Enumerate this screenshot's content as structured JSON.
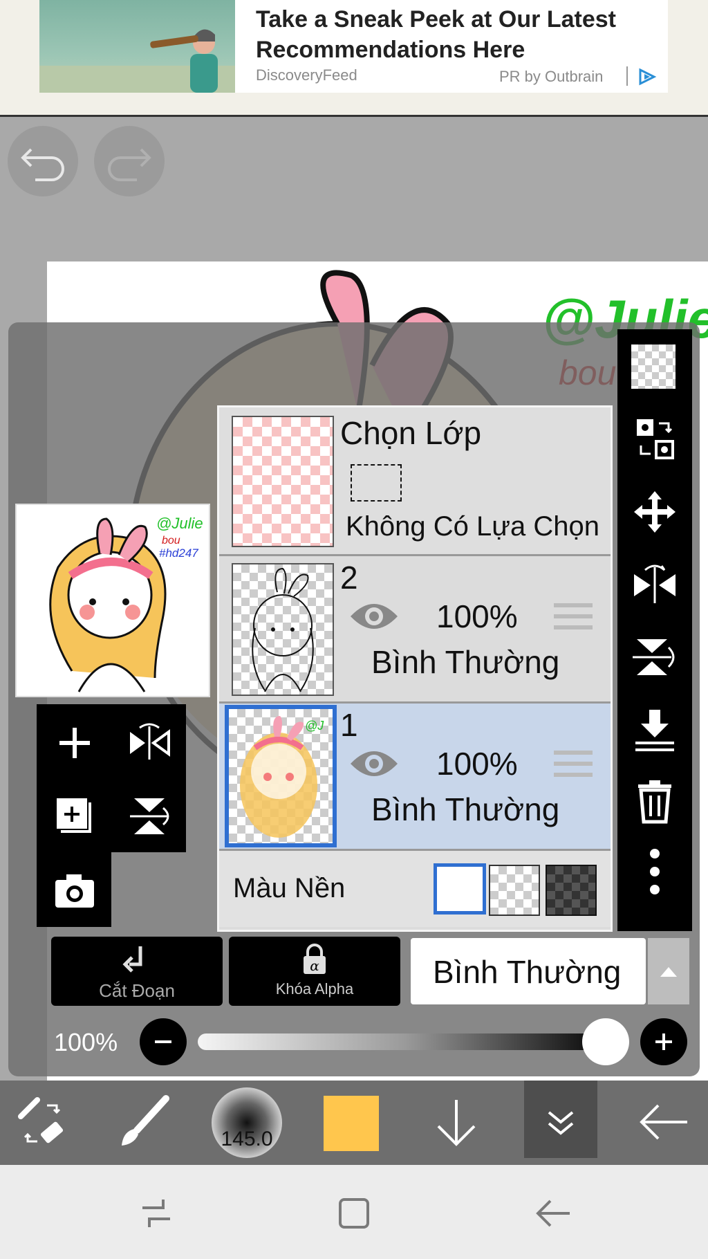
{
  "ad": {
    "title": "Take a Sneak Peek at Our Latest Recommendations Here",
    "source": "DiscoveryFeed",
    "sponsor": "PR by Outbrain"
  },
  "canvas": {
    "watermark_handle": "@Julie",
    "watermark_line2": "bou",
    "watermark_tag": "#hd247"
  },
  "layers": {
    "selection": {
      "title": "Chọn Lớp",
      "status": "Không Có Lựa Chọn"
    },
    "items": [
      {
        "name": "2",
        "opacity": "100%",
        "blend": "Bình Thường",
        "selected": false
      },
      {
        "name": "1",
        "opacity": "100%",
        "blend": "Bình Thường",
        "selected": true
      }
    ],
    "background_label": "Màu Nền"
  },
  "bottom_controls": {
    "clip_label": "Cắt Đoạn",
    "alpha_lock_label": "Khóa Alpha",
    "blend_mode": "Bình Thường",
    "opacity_label": "100%",
    "opacity_value": 1.0
  },
  "toolbar": {
    "brush_size": "145.0",
    "current_color": "#ffc64d"
  },
  "colors": {
    "selected_row": "#c8d6ea",
    "accent_blue": "#2f6fd1"
  }
}
